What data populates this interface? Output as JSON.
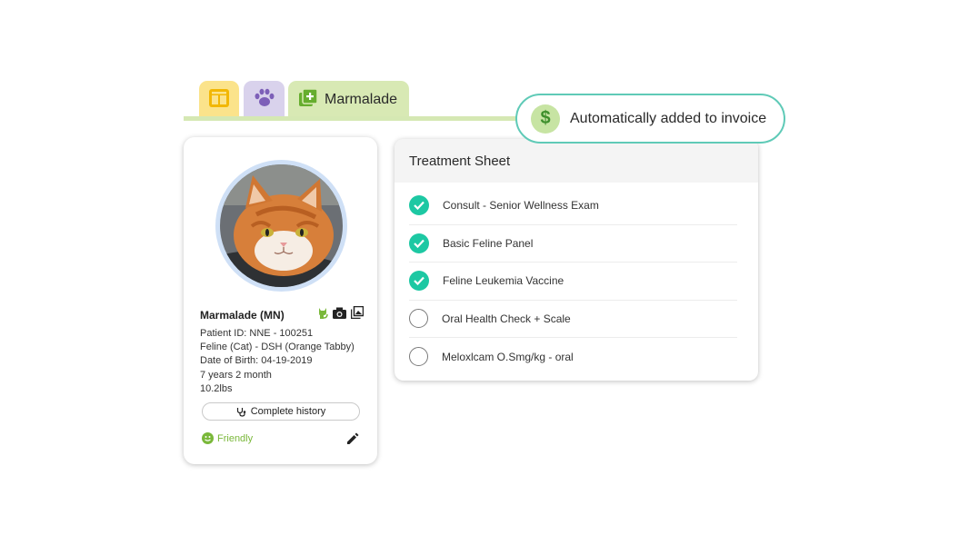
{
  "tabs": [
    {
      "icon": "dashboard-icon",
      "color": "#fbe38b"
    },
    {
      "icon": "paw-icon",
      "color": "#d9d2ec"
    },
    {
      "icon": "add-record-icon",
      "label": "Marmalade",
      "color": "#d8e9b4"
    }
  ],
  "invoice_notice": {
    "icon": "dollar-icon",
    "text": "Automatically added to invoice"
  },
  "patient": {
    "name": "Marmalade (MN)",
    "icons": [
      "cat-icon",
      "camera-icon",
      "gallery-icon"
    ],
    "patient_id": "Patient ID: NNE - 100251",
    "species": "Feline (Cat) - DSH (Orange Tabby)",
    "dob": "Date of Birth: 04-19-2019",
    "age": "7 years 2 month",
    "weight": "10.2lbs",
    "history_button": "Complete history",
    "temperament": "Friendly"
  },
  "treatment": {
    "title": "Treatment Sheet",
    "items": [
      {
        "label": "Consult - Senior Wellness Exam",
        "done": true
      },
      {
        "label": "Basic Feline Panel",
        "done": true
      },
      {
        "label": "Feline Leukemia Vaccine",
        "done": true
      },
      {
        "label": "Oral Health Check + Scale",
        "done": false
      },
      {
        "label": "Meloxlcam O.Smg/kg - oral",
        "done": false
      }
    ]
  },
  "colors": {
    "accent": "#1dc8a3",
    "pill_border": "#5fcab7",
    "friendly": "#7ab83a"
  }
}
